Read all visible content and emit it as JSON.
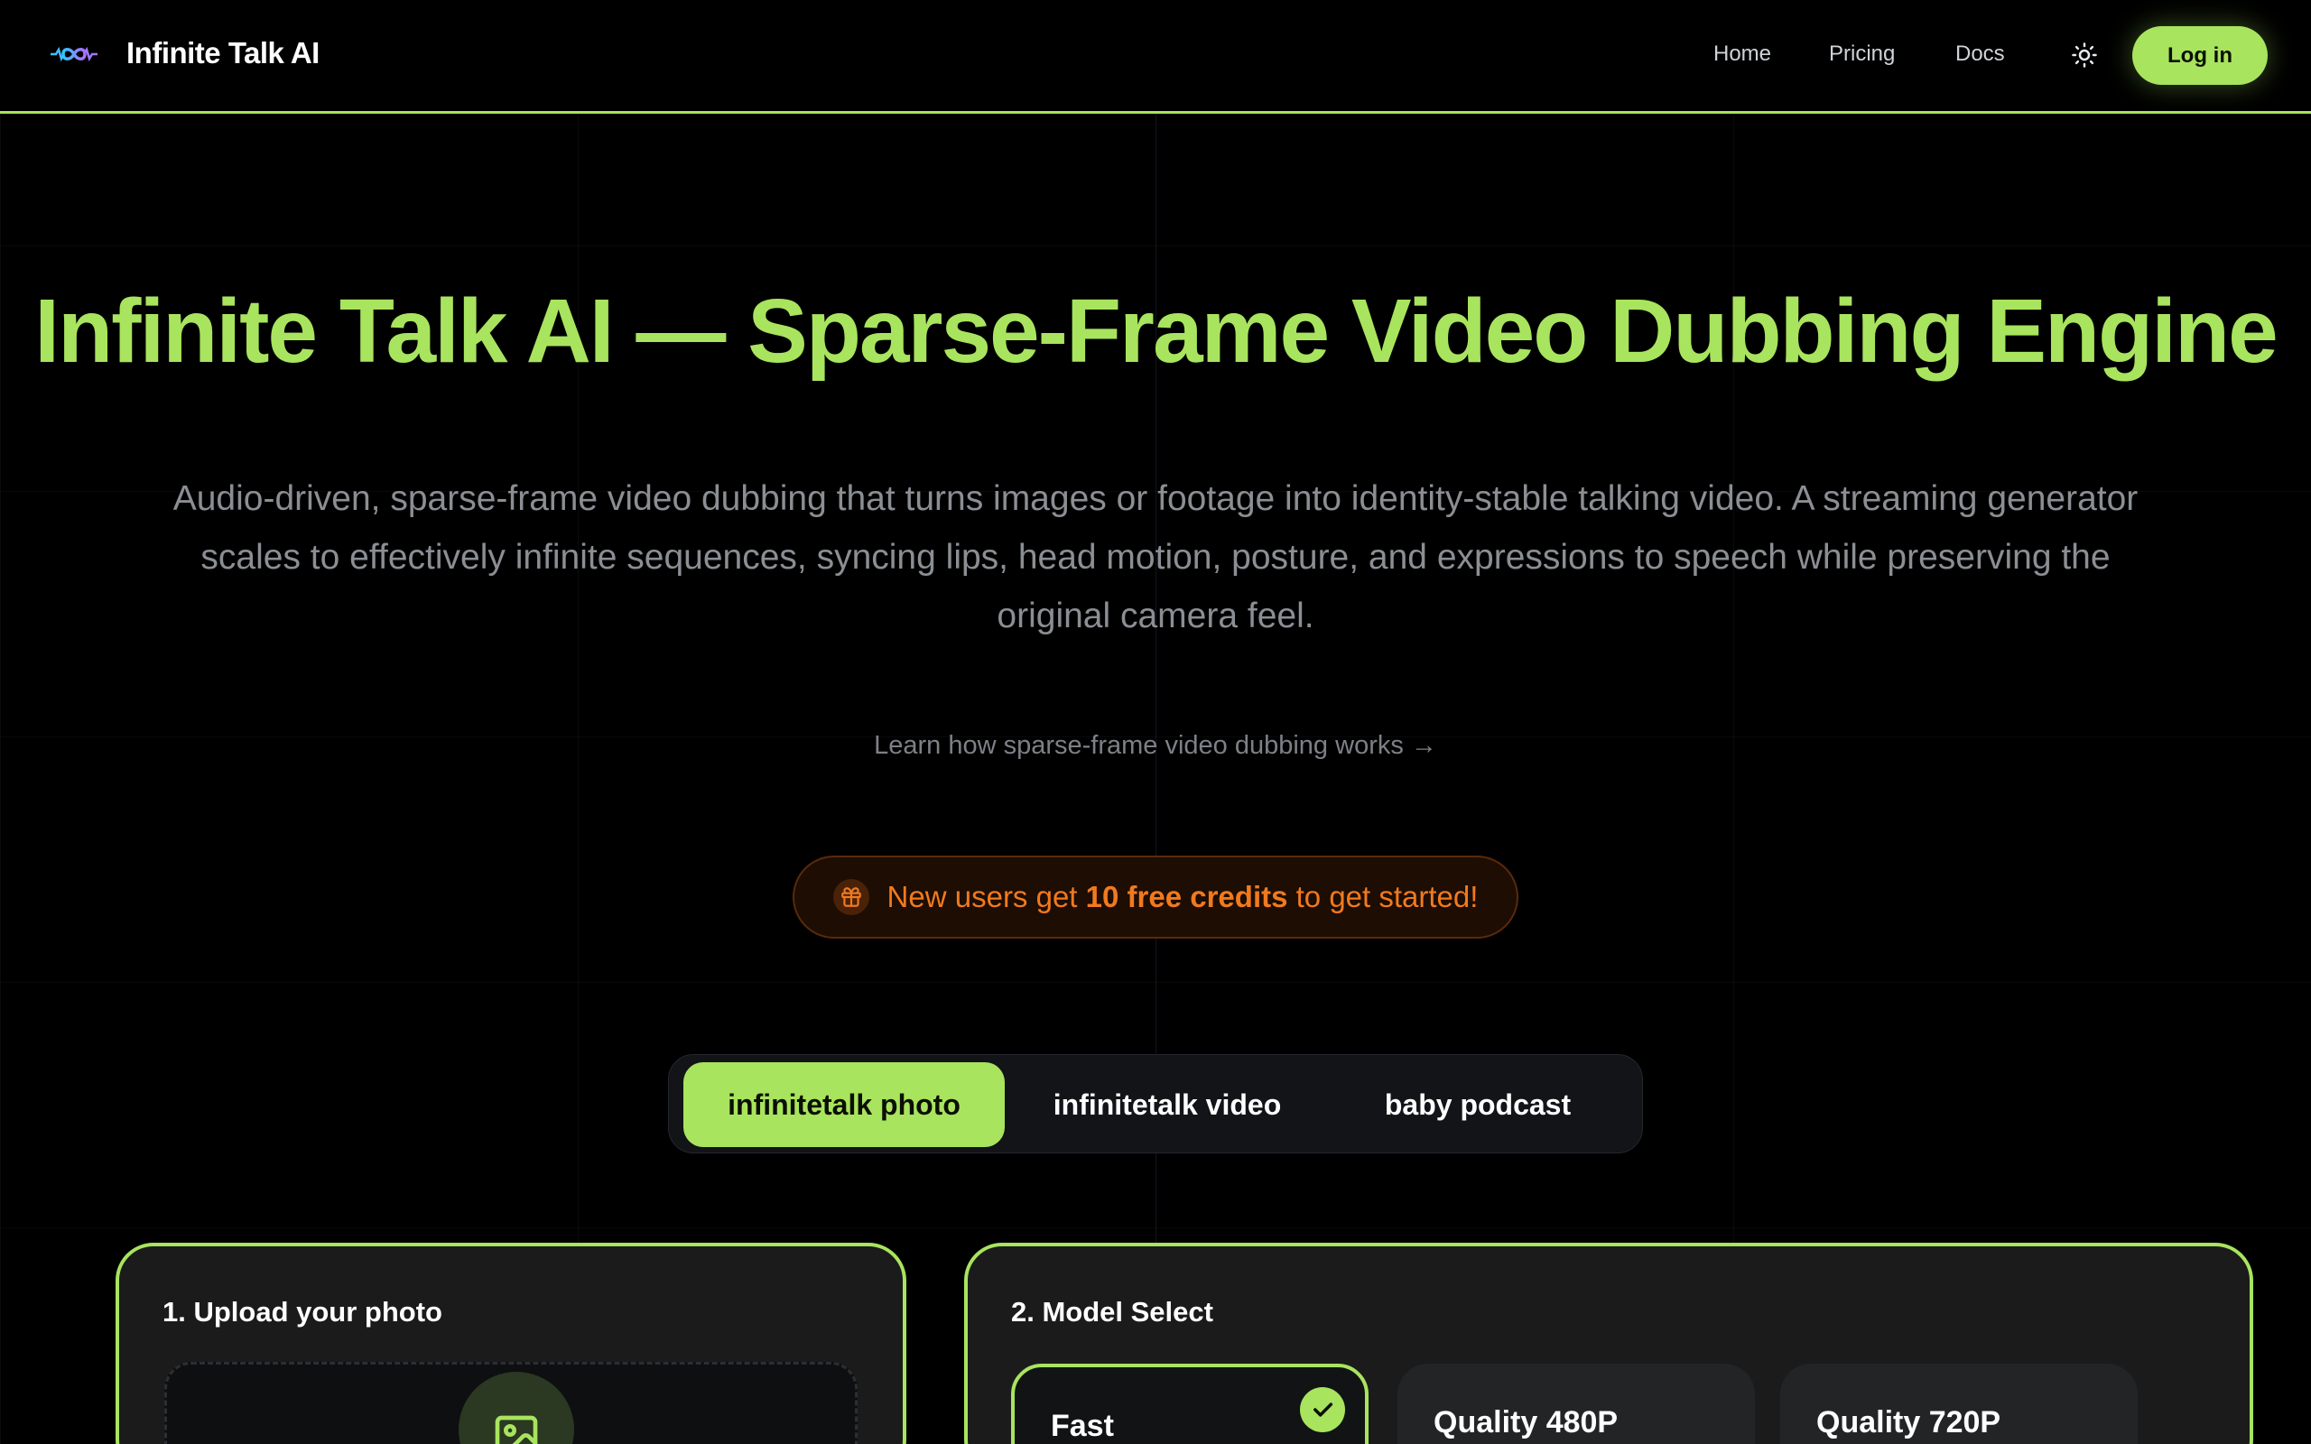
{
  "brand": {
    "name": "Infinite Talk AI",
    "accent": "#a8e45e"
  },
  "nav": {
    "links": [
      "Home",
      "Pricing",
      "Docs"
    ],
    "theme_icon": "sun-icon",
    "login_label": "Log in"
  },
  "hero": {
    "title": "Infinite Talk AI — Sparse-Frame Video Dubbing Engine",
    "description": "Audio-driven, sparse-frame video dubbing that turns images or footage into identity-stable talking video. A streaming generator scales to effectively infinite sequences, syncing lips, head motion, posture, and expressions to speech while preserving the original camera feel.",
    "learn_link": "Learn how sparse-frame video dubbing works →"
  },
  "promo": {
    "prefix": "New users get",
    "highlight": "10 free credits",
    "suffix": "to get started!",
    "icon": "gift-icon",
    "color": "#f07a1f"
  },
  "tabs": {
    "items": [
      "infinitetalk photo",
      "infinitetalk video",
      "baby podcast"
    ],
    "active": "infinitetalk photo"
  },
  "upload_card": {
    "title": "1. Upload your photo",
    "icon": "image-icon"
  },
  "model_card": {
    "title": "2. Model Select",
    "options": [
      "Fast",
      "Quality 480P",
      "Quality 720P"
    ],
    "selected": "Fast"
  }
}
